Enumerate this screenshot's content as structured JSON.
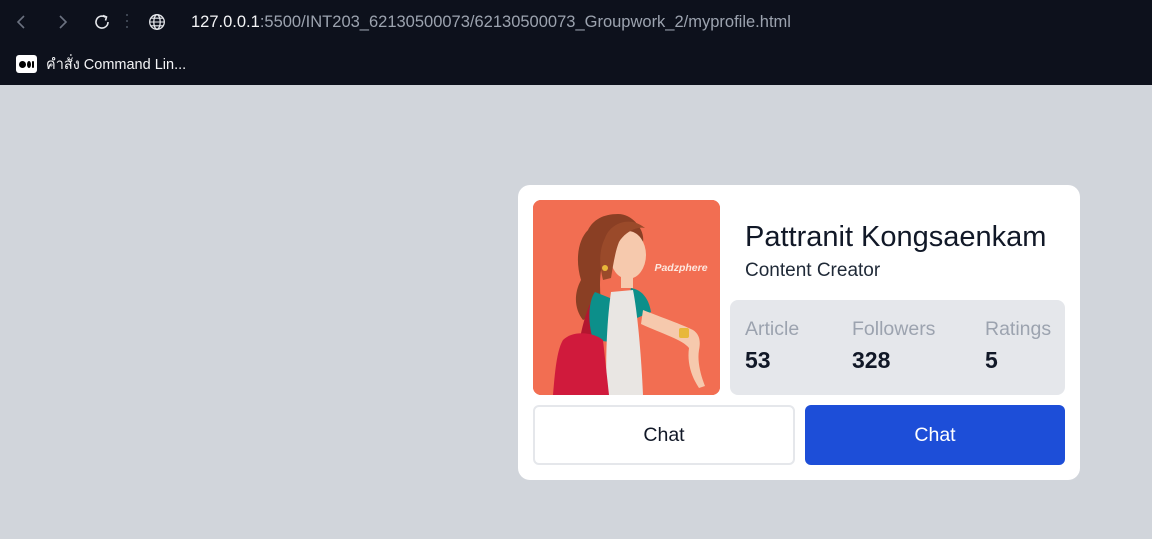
{
  "browser": {
    "url_host": "127.0.0.1",
    "url_rest": ":5500/INT203_62130500073/62130500073_Groupwork_2/myprofile.html",
    "bookmark_label": "คำสั่ง Command Lin...",
    "icons": {
      "back": "chevron-left-icon",
      "forward": "chevron-right-icon",
      "reload": "reload-icon",
      "site": "globe-icon",
      "bookmark": "medium-logo-icon"
    }
  },
  "profile": {
    "watermark": "Padzphere",
    "name": "Pattranit Kongsaenkam",
    "role": "Content Creator",
    "stats": [
      {
        "label": "Article",
        "value": "53"
      },
      {
        "label": "Followers",
        "value": "328"
      },
      {
        "label": "Ratings",
        "value": "5"
      }
    ],
    "buttons": {
      "secondary_label": "Chat",
      "primary_label": "Chat"
    }
  },
  "colors": {
    "page_background": "#d1d5db",
    "chrome_background": "#0d111c",
    "primary_button": "#1d4ed8",
    "avatar_background": "#f26e52"
  }
}
